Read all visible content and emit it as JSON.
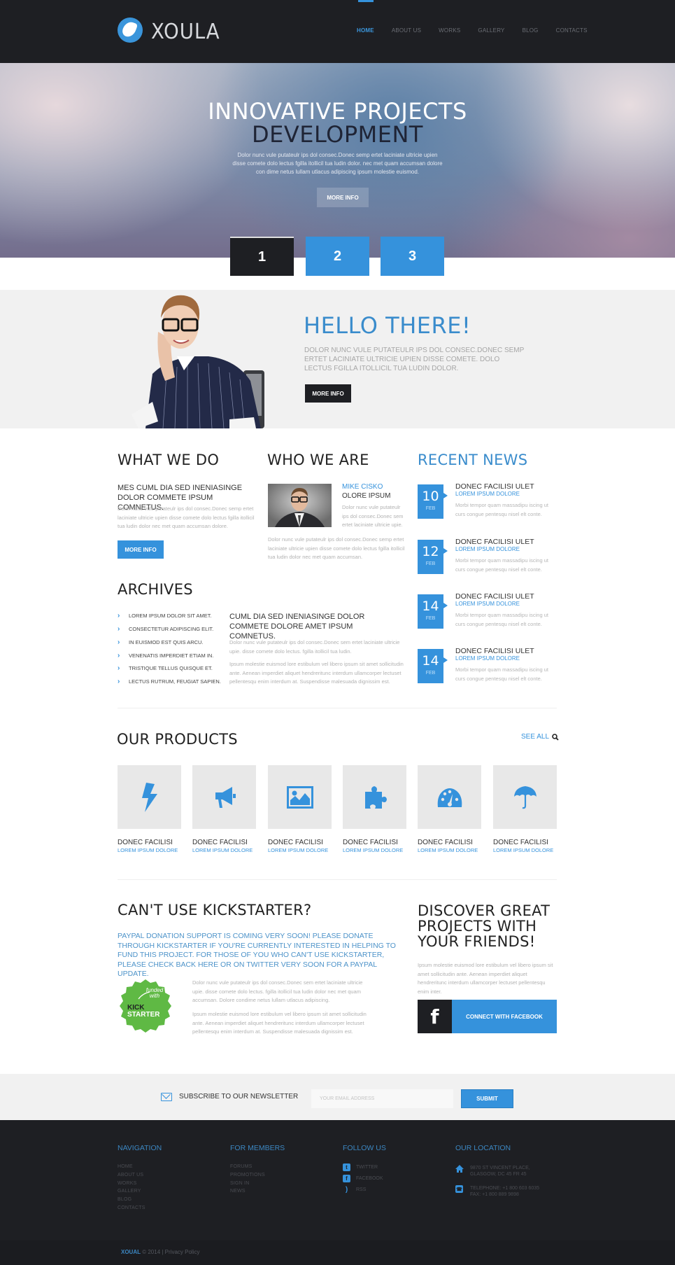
{
  "header": {
    "logo_text": "XOULA",
    "nav": [
      {
        "label": "HOME",
        "active": true
      },
      {
        "label": "ABOUT US"
      },
      {
        "label": "WORKS"
      },
      {
        "label": "GALLERY"
      },
      {
        "label": "BLOG"
      },
      {
        "label": "CONTACTS"
      }
    ]
  },
  "hero": {
    "title_line1": "INNOVATIVE PROJECTS",
    "title_line2": "DEVELOPMENT",
    "text": "Dolor nunc vule putateulr ips dol consec.Donec semp ertet laciniate ultricie upien disse comete dolo lectus fgilla itollicil tua ludin dolor. nec met quam accumsan dolore con dime netus lullam utlacus adipiscing ipsum molestie euismod.",
    "button": "MORE INFO",
    "slides": [
      "1",
      "2",
      "3"
    ],
    "active_slide": 1
  },
  "hello": {
    "title": "HELLO THERE!",
    "text": "DOLOR NUNC VULE PUTATEULR IPS DOL CONSEC.DONEC SEMP ERTET LACINIATE ULTRICIE UPIEN DISSE COMETE. DOLO LECTUS FGILLA ITOLLICIL TUA LUDIN DOLOR.",
    "button": "MORE INFO"
  },
  "what_we_do": {
    "title": "WHAT WE DO",
    "subhead": "MES CUML DIA SED INENIASINGE DOLOR COMMETE IPSUM COMNETUS.",
    "text": "Dolor nunc vule putateulr ips dol consec.Donec semp ertet laciniate ultricie upien disse comete dolo lectus fgilla itollicil tua ludin dolor nec met quam accumsan dolore.",
    "button": "MORE INFO"
  },
  "who_we_are": {
    "title": "WHO WE ARE",
    "name": "MIKE CISKO",
    "role": "OLORE IPSUM",
    "short_text": "Dolor nunc vule putateulr ips dol consec.Donec sem ertet laciniate ultricie upie.",
    "text": "Dolor nunc vule putateulr ips dol consec.Donec semp ertet laciniate ultricie upien disse comete dolo lectus fgilla itollicil tua ludin dolor nec met quam accumsan."
  },
  "recent_news": {
    "title": "RECENT NEWS",
    "items": [
      {
        "day": "10",
        "month": "FEB",
        "title": "DONEC FACILISI ULET",
        "subtitle": "LOREM IPSUM DOLORE",
        "text": "Morbi tempor quam massadipu iscing ut curs congue pentesqu nisel elt conte."
      },
      {
        "day": "12",
        "month": "FEB",
        "title": "DONEC FACILISI ULET",
        "subtitle": "LOREM IPSUM DOLORE",
        "text": "Morbi tempor quam massadipu iscing ut curs congue pentesqu nisel elt conte."
      },
      {
        "day": "14",
        "month": "FEB",
        "title": "DONEC FACILISI ULET",
        "subtitle": "LOREM IPSUM DOLORE",
        "text": "Morbi tempor quam massadipu iscing ut curs congue pentesqu nisel elt conte."
      },
      {
        "day": "14",
        "month": "FEB",
        "title": "DONEC FACILISI ULET",
        "subtitle": "LOREM IPSUM DOLORE",
        "text": "Morbi tempor quam massadipu iscing ut curs congue pentesqu nisel elt conte."
      }
    ]
  },
  "archives": {
    "title": "ARCHIVES",
    "items": [
      "LOREM IPSUM DOLOR SIT AMET.",
      "CONSECTETUR ADIPISCING ELIT.",
      "IN EUISMOD EST QUIS ARCU.",
      "VENENATIS IMPERDIET ETIAM IN.",
      "TRISTIQUE TELLUS QUISQUE ET.",
      "LECTUS RUTRUM, FEUGIAT SAPIEN."
    ],
    "subhead": "CUML DIA SED INENIASINGE DOLOR COMMETE DOLORE AMET IPSUM COMNETUS.",
    "text1": "Dolor nunc vule putateulr ips dol consec.Donec sem ertet laciniate ultricie upie. disse comete dolo lectus. fgilla itollicil tua ludin.",
    "text2": "Ipsum molestie euismod lore estibulum vel libero ipsum sit amet sollicitudin ante. Aenean imperdiet aliquet hendreritunc interdum ullamcorper lectuset pellentesqu enim interdum at. Suspendisse malesuada dignissim est."
  },
  "products": {
    "title": "OUR PRODUCTS",
    "see_all": "SEE ALL",
    "items": [
      {
        "icon": "lightning-icon",
        "name": "DONEC FACILISI",
        "sub": "LOREM IPSUM DOLORE"
      },
      {
        "icon": "megaphone-icon",
        "name": "DONEC FACILISI",
        "sub": "LOREM IPSUM DOLORE"
      },
      {
        "icon": "picture-icon",
        "name": "DONEC FACILISI",
        "sub": "LOREM IPSUM DOLORE"
      },
      {
        "icon": "puzzle-icon",
        "name": "DONEC FACILISI",
        "sub": "LOREM IPSUM DOLORE"
      },
      {
        "icon": "dashboard-icon",
        "name": "DONEC FACILISI",
        "sub": "LOREM IPSUM DOLORE"
      },
      {
        "icon": "umbrella-icon",
        "name": "DONEC FACILISI",
        "sub": "LOREM IPSUM DOLORE"
      }
    ]
  },
  "kickstarter": {
    "title": "CAN'T USE KICKSTARTER?",
    "blue_text": "PAYPAL DONATION SUPPORT IS COMING VERY SOON! PLEASE DONATE THROUGH KICKSTARTER IF YOU'RE CURRENTLY INTERESTED IN HELPING TO FUND THIS PROJECT. FOR THOSE OF YOU WHO CAN'T USE KICKSTARTER, PLEASE CHECK BACK HERE OR ON TWITTER VERY SOON FOR A PAYPAL UPDATE.",
    "badge_top": "funded with",
    "badge_line1": "KICK",
    "badge_line2": "STARTER",
    "text1": "Dolor nunc vule putateulr ips dol consec.Donec sem ertet laciniate ultricie upie. disse comete dolo lectus. fgilla itollicil tua ludin dolor nec met quam accumsan. Dolore condime netus lullam utlacus adipiscing.",
    "text2": "Ipsum molestie euismod lore estibulum vel libero ipsum sit amet sollicitudin ante. Aenean imperdiet aliquet hendreritunc interdum ullamcorper lectuset pellentesqu enim interdum at. Suspendisse malesuada dignissim est."
  },
  "discover": {
    "title": "DISCOVER GREAT PROJECTS WITH YOUR FRIENDS!",
    "text": "Ipsum molestie euismod lore estibulum vel libero ipsum sit amet sollicitudin ante. Aenean imperdiet aliquet hendreritunc interdum ullamcorper lectuset pellentesqu enim inter.",
    "fb_icon": "f",
    "fb_button": "CONNECT WITH FACEBOOK"
  },
  "newsletter": {
    "label": "SUBSCRIBE TO OUR NEWSLETTER",
    "placeholder": "YOUR EMAIL ADDRESS",
    "value": "",
    "submit": "SUBMIT"
  },
  "footer": {
    "navigation": {
      "title": "NAVIGATION",
      "links": [
        "HOME",
        "ABOUT US",
        "WORKS",
        "GALLERY",
        "BLOG",
        "CONTACTS"
      ]
    },
    "members": {
      "title": "FOR MEMBERS",
      "links": [
        "FORUMS",
        "PROMOTIONS",
        "SIGN IN",
        "NEWS"
      ]
    },
    "follow": {
      "title": "FOLLOW US",
      "links": [
        {
          "icon": "twitter-icon",
          "label": "TWITTER"
        },
        {
          "icon": "facebook-icon",
          "label": "FACEBOOK"
        },
        {
          "icon": "rss-icon",
          "label": "RSS"
        }
      ]
    },
    "location": {
      "title": "OUR LOCATION",
      "address_line1": "9870 ST VINCENT PLACE,",
      "address_line2": "GLASGOW, DC 45 FR 45",
      "phone": "TELEPHONE: +1 800 603 6035",
      "fax": "FAX: +1 800 889 9898"
    },
    "copyright_brand": "XOUAL",
    "copyright_text": "© 2014 | Privacy Policy"
  },
  "colors": {
    "accent": "#3592dc",
    "dark": "#1e1f23",
    "light_bg": "#f1f1f1",
    "kickstarter_green": "#5fb944"
  }
}
